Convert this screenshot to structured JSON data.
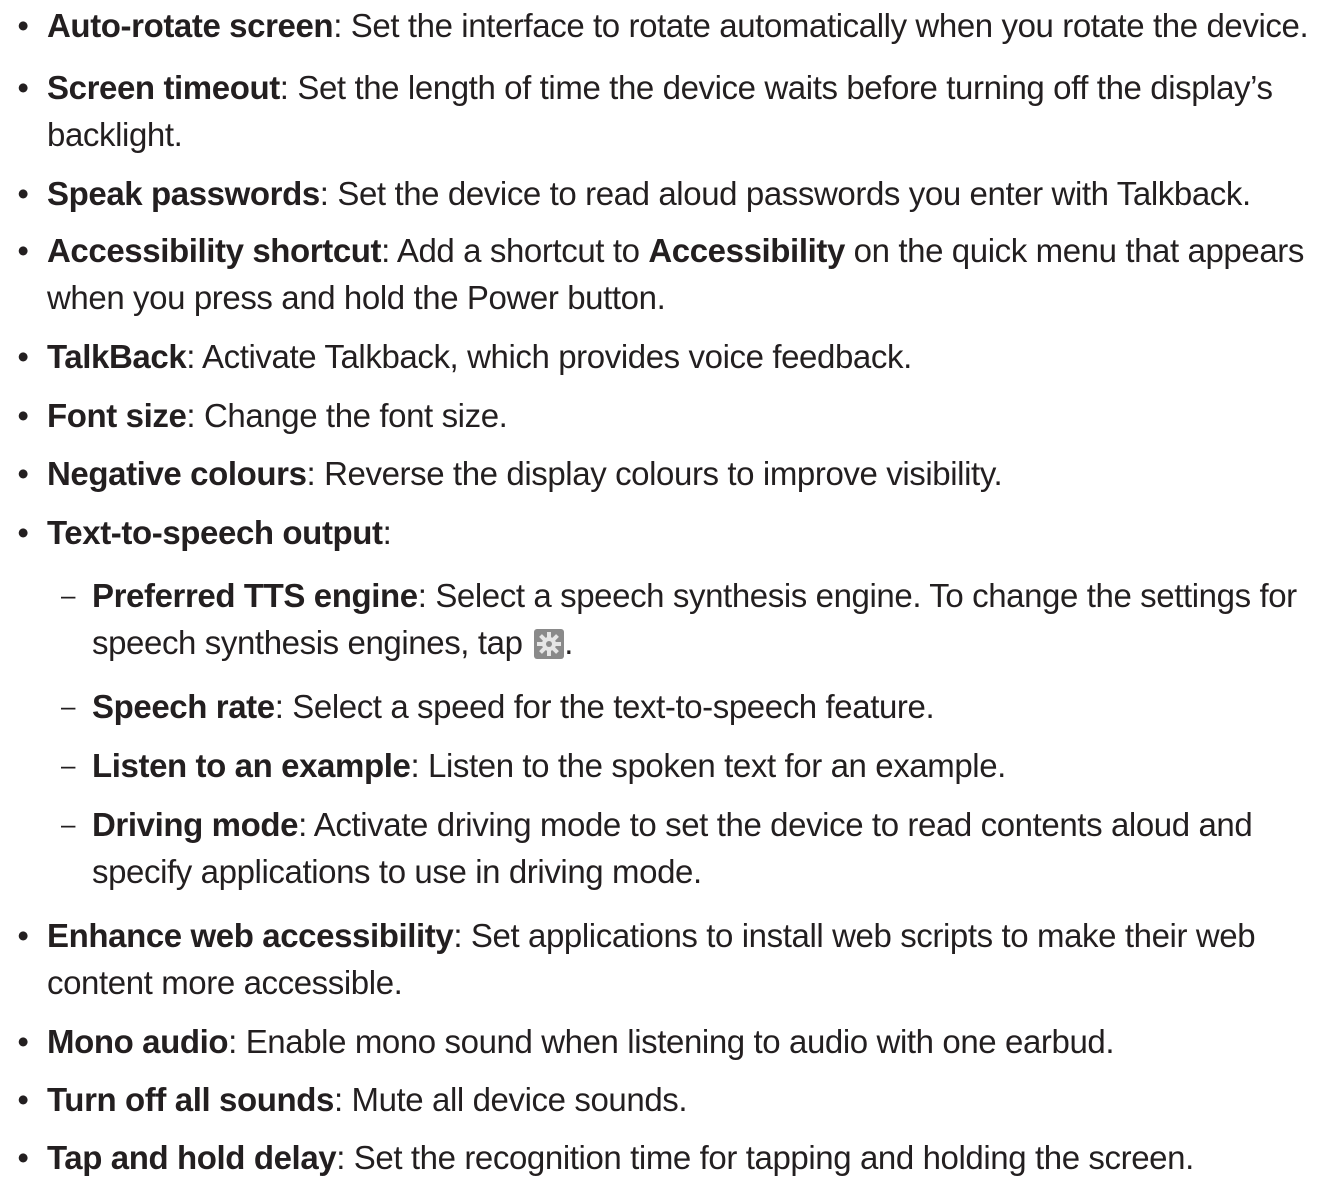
{
  "items": [
    {
      "term": "Auto-rotate screen",
      "sep": ":",
      "desc": " Set the interface to rotate automatically when you rotate the device."
    },
    {
      "term": "Screen timeout",
      "sep": ":",
      "desc": " Set the length of time the device waits before turning off the display’s backlight."
    },
    {
      "term": "Speak passwords",
      "sep": ":",
      "desc": " Set the device to read aloud passwords you enter with Talkback."
    },
    {
      "term": "Accessibility shortcut",
      "sep": ":",
      "desc_a": " Add a shortcut to ",
      "desc_term": "Accessibility",
      "desc_b": " on the quick menu that appears when you press and hold the Power button."
    },
    {
      "term": "TalkBack",
      "sep": ":",
      "desc": " Activate Talkback, which provides voice feedback."
    },
    {
      "term": "Font size",
      "sep": ":",
      "desc": " Change the font size."
    },
    {
      "term": "Negative colours",
      "sep": ":",
      "desc": " Reverse the display colours to improve visibility."
    },
    {
      "term": "Text-to-speech output",
      "sep": ":"
    },
    {
      "term": "Enhance web accessibility",
      "sep": ":",
      "desc": " Set applications to install web scripts to make their web content more accessible."
    },
    {
      "term": "Mono audio",
      "sep": ":",
      "desc": " Enable mono sound when listening to audio with one earbud."
    },
    {
      "term": "Turn off all sounds",
      "sep": ":",
      "desc": " Mute all device sounds."
    },
    {
      "term": "Tap and hold delay",
      "sep": ":",
      "desc": " Set the recognition time for tapping and holding the screen."
    }
  ],
  "subitems": [
    {
      "term": "Preferred TTS engine",
      "sep": ":",
      "desc_a": " Select a speech synthesis engine. To change the settings for speech synthesis engines, tap ",
      "desc_b": "."
    },
    {
      "term": "Speech rate",
      "sep": ":",
      "desc": " Select a speed for the text-to-speech feature."
    },
    {
      "term": "Listen to an example",
      "sep": ":",
      "desc": " Listen to the spoken text for an example."
    },
    {
      "term": "Driving mode",
      "sep": ":",
      "desc": " Activate driving mode to set the device to read contents aloud and specify applications to use in driving mode."
    }
  ],
  "markers": {
    "bullet": "•",
    "dash": "–"
  },
  "icons": {
    "settings": "gear-icon"
  },
  "colors": {
    "text": "#231f20",
    "icon_bg": "#8a8a8a"
  }
}
